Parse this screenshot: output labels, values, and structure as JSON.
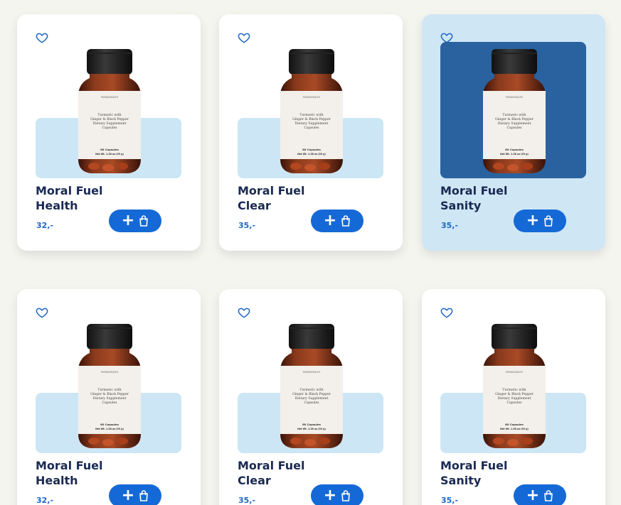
{
  "products": [
    {
      "name_line1": "Moral Fuel",
      "name_line2": "Health",
      "price": "32,-",
      "selected": false
    },
    {
      "name_line1": "Moral Fuel",
      "name_line2": "Clear",
      "price": "35,-",
      "selected": false
    },
    {
      "name_line1": "Moral Fuel",
      "name_line2": "Sanity",
      "price": "35,-",
      "selected": true
    },
    {
      "name_line1": "Moral Fuel",
      "name_line2": "Health",
      "price": "32,-",
      "selected": false
    },
    {
      "name_line1": "Moral Fuel",
      "name_line2": "Clear",
      "price": "35,-",
      "selected": false
    },
    {
      "name_line1": "Moral Fuel",
      "name_line2": "Sanity",
      "price": "35,-",
      "selected": false
    }
  ],
  "bottle_label": {
    "brand": "PURAVHEALTH",
    "line1": "Turmeric with",
    "line2": "Ginger & Black Pepper",
    "line3": "Dietary Supplement",
    "line4": "Capsules",
    "count": "60 Capsules",
    "weight": "Net Wt. 1.38 oz (39 g)"
  },
  "icons": {
    "favorite": "heart-outline-icon",
    "add": "plus-icon",
    "cart": "shopping-bag-icon"
  },
  "colors": {
    "page_bg": "#f5f5f0",
    "card_bg": "#ffffff",
    "card_selected_bg": "#cfe6f5",
    "image_backdrop": "#cde6f5",
    "image_backdrop_selected": "#2a62a0",
    "title": "#1a2a52",
    "price": "#1f67c4",
    "button": "#1569d6"
  }
}
